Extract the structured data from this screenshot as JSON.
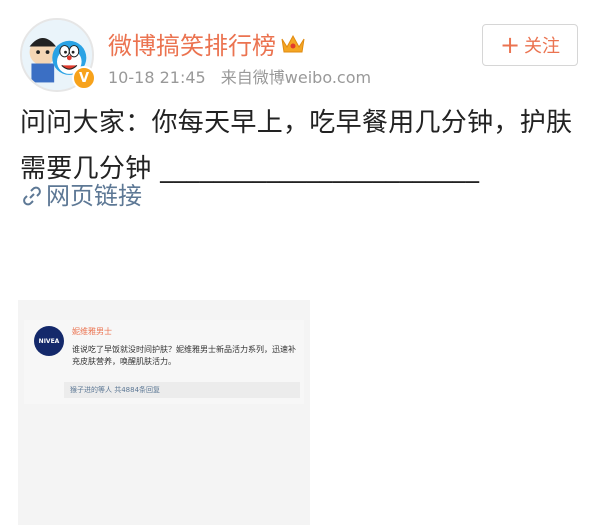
{
  "user": {
    "name": "微博搞笑排行榜",
    "timestamp": "10-18 21:45",
    "source": "来自微博weibo.com"
  },
  "follow_button": {
    "plus": "+",
    "label": "关注"
  },
  "post": {
    "text": "问问大家：你每天早上，吃早餐用几分钟，护肤需要几分钟 ________________________",
    "link_label": "网页链接"
  },
  "embedded": {
    "brand": "NIVEA",
    "name": "妮维雅男士",
    "text": "谁说吃了早饭就没时间护肤？妮维雅男士新品活力系列，迅速补充皮肤营养，唤醒肌肤活力。",
    "comment": "猴子进的等人  共4884条回复"
  },
  "colors": {
    "accent": "#eb7350",
    "link": "#5d7895",
    "verify": "#f7a21b"
  },
  "icons": [
    "avatar-doraemon",
    "verified-badge-icon",
    "crown-icon",
    "link-icon"
  ]
}
